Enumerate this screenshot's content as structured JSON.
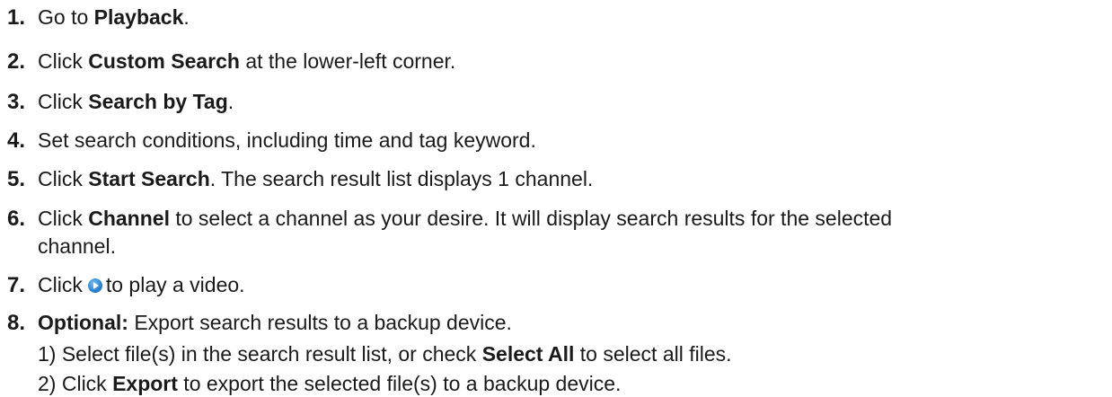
{
  "steps": [
    {
      "num": "1.",
      "pre": "Go to ",
      "bold": "Playback",
      "post": "."
    },
    {
      "num": "2.",
      "pre": "Click ",
      "bold": "Custom Search",
      "post": " at the lower-left corner."
    },
    {
      "num": "3.",
      "pre": "Click ",
      "bold": "Search by Tag",
      "post": "."
    },
    {
      "num": "4.",
      "pre": "Set search conditions, including time and tag keyword.",
      "bold": "",
      "post": ""
    },
    {
      "num": "5.",
      "pre": "Click ",
      "bold": "Start Search",
      "post": ". The search result list displays 1 channel."
    },
    {
      "num": "6.",
      "pre": "Click ",
      "bold": "Channel",
      "post": " to select a channel as your desire. It will display search results for the selected",
      "cont": "channel."
    },
    {
      "num": "7.",
      "pre": "Click",
      "icon": "play-icon",
      "post": "to play a video."
    },
    {
      "num": "8.",
      "pre": "",
      "bold": "Optional:",
      "post": " Export search results to a backup device."
    }
  ],
  "substeps": [
    {
      "num": "1)",
      "pre": " Select file(s) in the search result list, or check ",
      "bold": "Select All",
      "post": " to select all files."
    },
    {
      "num": "2)",
      "pre": " Click ",
      "bold": "Export",
      "post": " to export the selected file(s) to a backup device."
    }
  ]
}
